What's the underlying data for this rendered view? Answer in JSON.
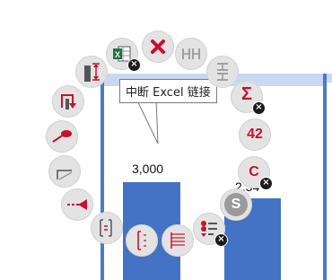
{
  "tooltip": {
    "text": "中断 Excel 链接"
  },
  "chart": {
    "labels": [
      "3,000",
      "2,34"
    ]
  },
  "menu": {
    "items": [
      {
        "id": "excel",
        "icon": "excel-icon",
        "badge": "remove"
      },
      {
        "id": "delete",
        "icon": "close-icon"
      },
      {
        "id": "gap-horizontal",
        "icon": "horizontal-gap-icon"
      },
      {
        "id": "gap-vertical",
        "icon": "vertical-gap-icon"
      },
      {
        "id": "sum",
        "icon": "sigma-icon",
        "text": "Σ",
        "badge": "remove"
      },
      {
        "id": "label-number",
        "icon": "value-label-icon",
        "text": "42"
      },
      {
        "id": "category",
        "icon": "category-label-icon",
        "text": "C",
        "badge": "remove"
      },
      {
        "id": "series",
        "icon": "series-label-icon",
        "text": "S"
      },
      {
        "id": "legend",
        "icon": "legend-icon",
        "badge": "remove"
      },
      {
        "id": "axis-lines",
        "icon": "axis-lines-icon"
      },
      {
        "id": "axis-bracket",
        "icon": "axis-bracket-icon"
      },
      {
        "id": "axis-break",
        "icon": "axis-break-icon"
      },
      {
        "id": "arrow-line",
        "icon": "arrow-line-icon"
      },
      {
        "id": "step",
        "icon": "step-line-icon"
      },
      {
        "id": "connector",
        "icon": "connector-icon"
      },
      {
        "id": "elbow",
        "icon": "elbow-arrow-icon"
      },
      {
        "id": "height",
        "icon": "height-difference-icon"
      }
    ]
  },
  "colors": {
    "accent": "#c8102e",
    "bar": "#4472c4",
    "button_bg": "#e3e3e3"
  }
}
